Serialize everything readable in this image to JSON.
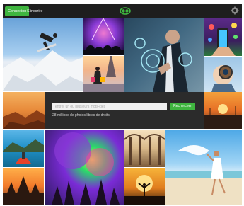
{
  "topbar": {
    "primary_button": "Connexion",
    "nav_link": "S'inscrire"
  },
  "search": {
    "placeholder": "entrer un ou plusieurs mots-clés",
    "button_label": "Rechercher",
    "tagline": "28 millions de photos libres de droits"
  },
  "icons": {
    "logo": "brand-logo-icon",
    "settings": "gear-icon"
  },
  "colors": {
    "accent": "#3fb53f",
    "bar": "#1e1e1e",
    "panel": "#2b2b2b"
  }
}
